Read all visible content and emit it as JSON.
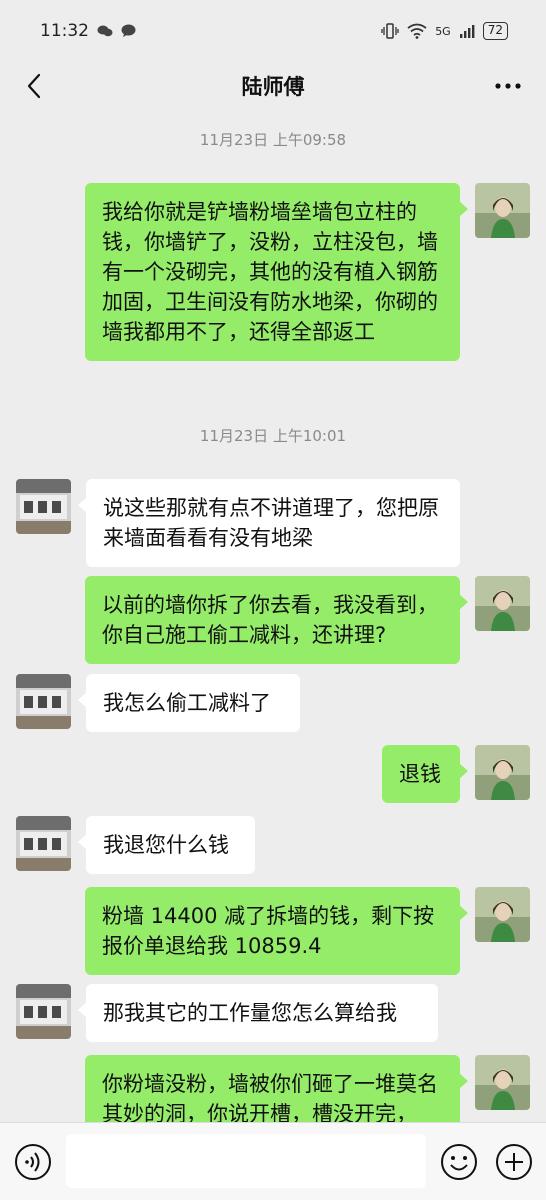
{
  "status": {
    "time": "11:32",
    "network": "5G",
    "battery": "72"
  },
  "header": {
    "title": "陆师傅",
    "back_icon": "chevron-left-icon",
    "more_icon": "more-horizontal-icon"
  },
  "messages": [
    {
      "type": "time",
      "text": "11月23日 上午09:58"
    },
    {
      "type": "msg",
      "from": "me",
      "text": "我给你就是铲墙粉墙垒墙包立柱的钱，你墙铲了，没粉，立柱没包，墙有一个没砌完，其他的没有植入钢筋加固，卫生间没有防水地梁，你砌的墙我都用不了，还得全部返工"
    },
    {
      "type": "time",
      "text": "11月23日 上午10:01"
    },
    {
      "type": "msg",
      "from": "other",
      "text": "说这些那就有点不讲道理了，您把原来墙面看看有没有地梁"
    },
    {
      "type": "msg",
      "from": "me",
      "text": "以前的墙你拆了你去看，我没看到，你自己施工偷工减料，还讲理?"
    },
    {
      "type": "msg",
      "from": "other",
      "text": "我怎么偷工减料了"
    },
    {
      "type": "msg",
      "from": "me",
      "text": "退钱"
    },
    {
      "type": "msg",
      "from": "other",
      "text": "我退您什么钱"
    },
    {
      "type": "msg",
      "from": "me",
      "text": "粉墙 14400 减了拆墙的钱，剩下按报价单退给我 10859.4"
    },
    {
      "type": "msg",
      "from": "other",
      "text": "那我其它的工作量您怎么算给我"
    },
    {
      "type": "msg",
      "from": "me",
      "text": "你粉墙没粉，墙被你们砸了一堆莫名其妙的洞，你说开槽，槽没开完，"
    }
  ],
  "input": {
    "voice_icon": "voice-icon",
    "emoji_icon": "emoji-icon",
    "plus_icon": "plus-icon",
    "value": ""
  }
}
